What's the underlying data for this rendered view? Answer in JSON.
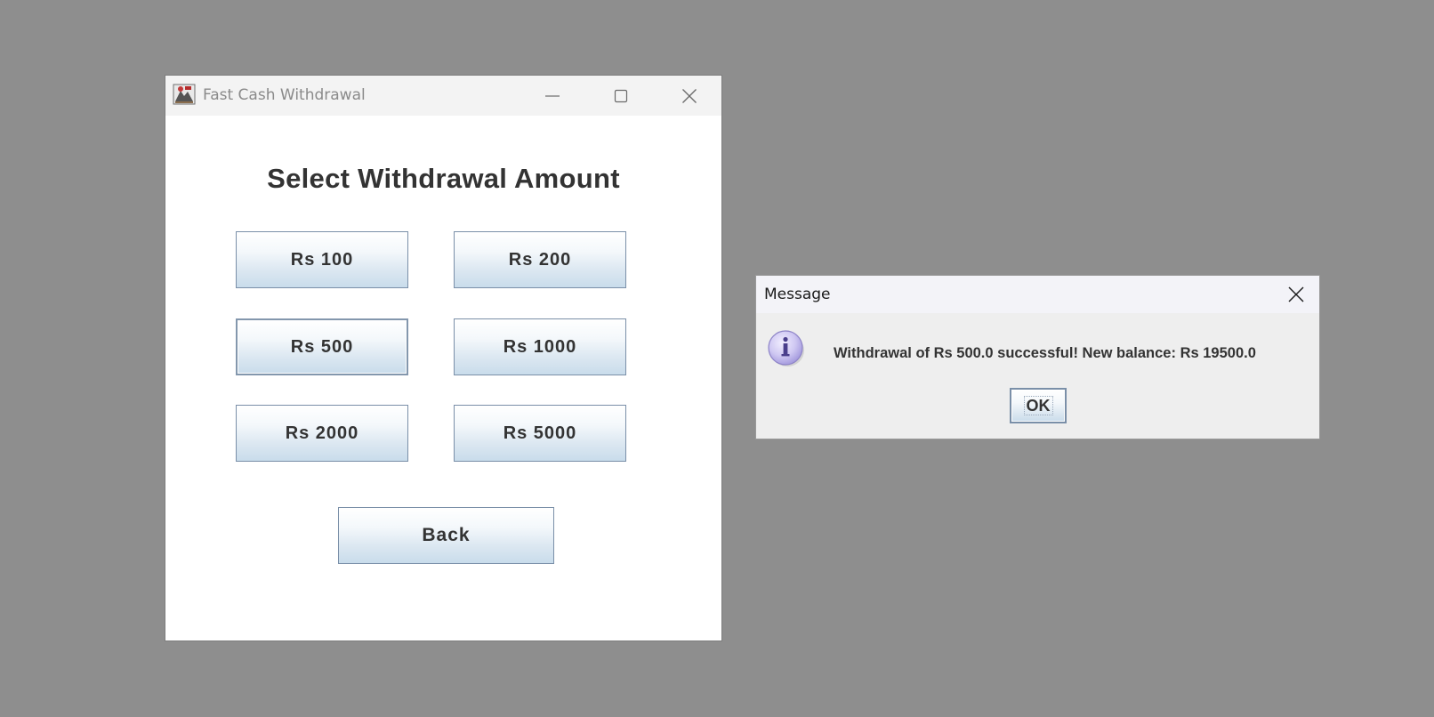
{
  "main_window": {
    "title": "Fast Cash Withdrawal",
    "heading": "Select Withdrawal Amount",
    "amount_buttons": [
      {
        "label": "Rs 100"
      },
      {
        "label": "Rs 200"
      },
      {
        "label": "Rs 500"
      },
      {
        "label": "Rs 1000"
      },
      {
        "label": "Rs 2000"
      },
      {
        "label": "Rs 5000"
      }
    ],
    "back_label": "Back",
    "icons": [
      "app-icon",
      "minimize-icon",
      "maximize-icon",
      "close-icon"
    ]
  },
  "dialog": {
    "title": "Message",
    "message": "Withdrawal of Rs 500.0 successful! New balance: Rs 19500.0",
    "ok_label": "OK",
    "icons": [
      "info-icon",
      "close-icon"
    ]
  },
  "colors": {
    "desktop_background": "#8e8e8e",
    "window_background": "#ffffff",
    "dialog_background": "#eeeeee",
    "button_border": "#7a8fa8",
    "info_icon_fill": "#c9c3ee"
  }
}
